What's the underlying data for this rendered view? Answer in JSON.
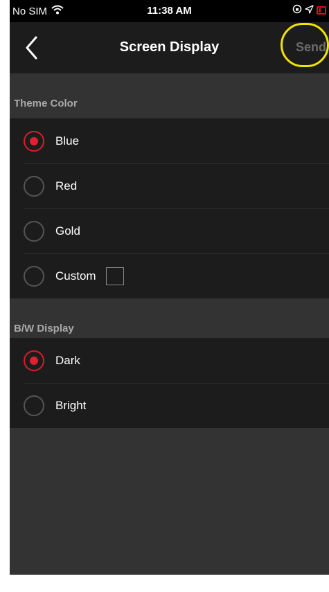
{
  "status_bar": {
    "carrier": "No SIM",
    "time": "11:38 AM"
  },
  "nav": {
    "title": "Screen Display",
    "send_label": "Send"
  },
  "theme": {
    "header": "Theme Color",
    "options": [
      {
        "label": "Blue",
        "selected": true
      },
      {
        "label": "Red",
        "selected": false
      },
      {
        "label": "Gold",
        "selected": false
      },
      {
        "label": "Custom",
        "selected": false
      }
    ]
  },
  "bw": {
    "header": "B/W Display",
    "options": [
      {
        "label": "Dark",
        "selected": true
      },
      {
        "label": "Bright",
        "selected": false
      }
    ]
  },
  "colors": {
    "accent": "#e02030",
    "highlight": "#f0e400"
  },
  "icons": [
    "wifi-icon",
    "lock-rotation-icon",
    "location-arrow-icon",
    "battery-icon",
    "back-chevron-icon"
  ]
}
